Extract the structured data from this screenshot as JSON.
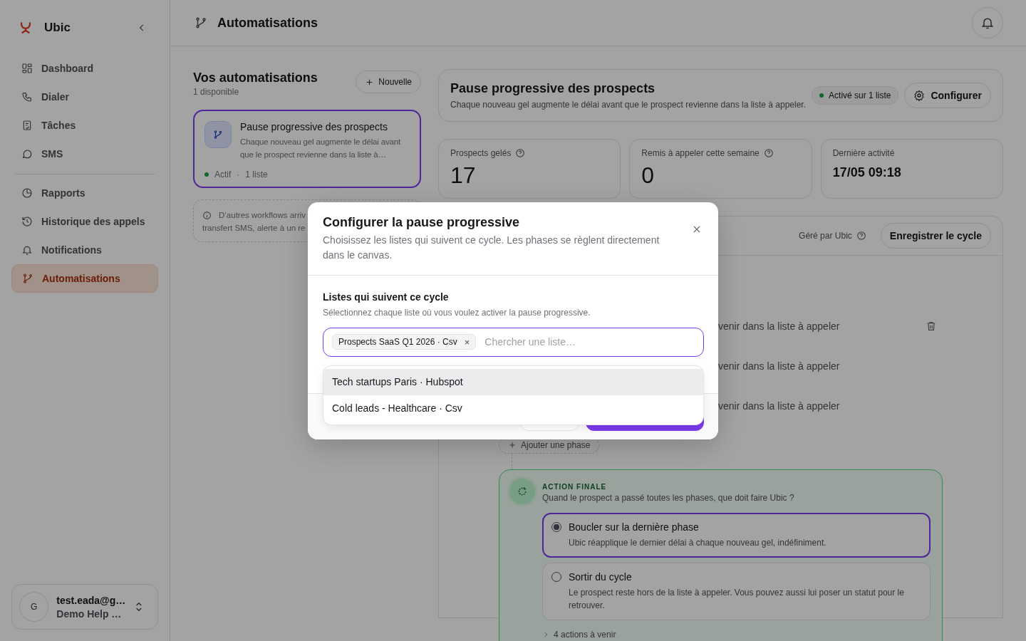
{
  "sidebar": {
    "brand": "Ubic",
    "nav_groups": [
      [
        {
          "label": "Dashboard",
          "selected": false
        },
        {
          "label": "Dialer",
          "selected": false
        },
        {
          "label": "Tâches",
          "selected": false
        },
        {
          "label": "SMS",
          "selected": false
        }
      ],
      [
        {
          "label": "Rapports",
          "selected": false
        },
        {
          "label": "Historique des appels",
          "selected": false
        },
        {
          "label": "Notifications",
          "selected": false
        },
        {
          "label": "Automatisations",
          "selected": true
        }
      ]
    ],
    "user": {
      "avatar": "G",
      "email": "test.eada@g…",
      "workspace": "Demo Help …"
    }
  },
  "header": {
    "title": "Automatisations"
  },
  "automations": {
    "title": "Vos automatisations",
    "count": "1 disponible",
    "new_button": "Nouvelle",
    "items": [
      {
        "title": "Pause progressive des prospects",
        "description": "Chaque nouveau gel augmente le délai avant que le prospect revienne dans la liste à…",
        "status": "Actif",
        "separator": "·",
        "lists": "1 liste",
        "selected": true
      }
    ],
    "info_lines": [
      "D’autres workflows arriv",
      "transfert SMS, alerte à un re"
    ]
  },
  "detail": {
    "title": "Pause progressive des prospects",
    "description": "Chaque nouveau gel augmente le délai avant que le prospect revienne dans la liste à appeler.",
    "badge": "Activé sur 1 liste",
    "configure_button": "Configurer",
    "stats": [
      {
        "kind": "count",
        "label": "Prospects gelés",
        "value": "17"
      },
      {
        "kind": "count",
        "label": "Remis à appeler cette semaine",
        "value": "0"
      },
      {
        "kind": "date",
        "label": "Dernière activité",
        "value": "17/05 09:18"
      }
    ],
    "canvas": {
      "managed_by": "Géré par Ubic",
      "save_button": "Enregistrer le cycle",
      "phases": [
        {
          "text": "venir dans la liste à appeler",
          "deletable": true
        },
        {
          "text": "venir dans la liste à appeler",
          "deletable": false
        },
        {
          "text": "venir dans la liste à appeler",
          "deletable": false
        }
      ],
      "add_phase": "Ajouter une phase",
      "final_action": {
        "label": "ACTION FINALE",
        "question": "Quand le prospect a passé toutes les phases, que doit faire Ubic ?",
        "options": [
          {
            "title": "Boucler sur la dernière phase",
            "description": "Ubic réapplique le dernier délai à chaque nouveau gel, indéfiniment.",
            "selected": true
          },
          {
            "title": "Sortir du cycle",
            "description": "Le prospect reste hors de la liste à appeler. Vous pouvez aussi lui poser un statut pour le retrouver.",
            "selected": false
          }
        ],
        "more": "4 actions à venir"
      }
    }
  },
  "modal": {
    "title": "Configurer la pause progressive",
    "description": "Choisissez les listes qui suivent ce cycle. Les phases se règlent directement dans le canvas.",
    "section_label": "Listes qui suivent ce cycle",
    "hint": "Sélectionnez chaque liste où vous voulez activer la pause progressive.",
    "chips": [
      {
        "label": "Prospects SaaS Q1 2026 · Csv",
        "remove": "×"
      }
    ],
    "placeholder": "Chercher une liste…",
    "options": [
      {
        "label": "Tech startups Paris · Hubspot",
        "highlighted": true
      },
      {
        "label": "Cold leads - Healthcare · Csv",
        "highlighted": false
      }
    ]
  }
}
